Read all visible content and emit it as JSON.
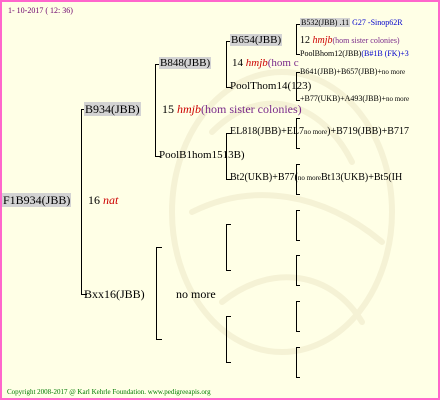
{
  "header": {
    "date": "1- 10-2017 ( 12: 36)"
  },
  "footer": {
    "text": "Copyright 2008-2017 @ Karl Kehrle Foundation.   www.pedigreeapis.org"
  },
  "colors": {
    "border": "#ff66cc",
    "background": "#ffffe6",
    "box": "#d3d3d3",
    "red": "#cc0000",
    "purple": "#7a2a8a",
    "blue": "#0000cc"
  },
  "gen0": {
    "label": "F1B934(JBB)",
    "num": "16",
    "note": "nat"
  },
  "gen1": [
    {
      "label": "B934(JBB)",
      "num": "15",
      "note": "hmjb",
      "note2": "(hom sister colonies)"
    },
    {
      "label": "Bxx16(JBB)",
      "extra": "no more"
    }
  ],
  "gen2": [
    {
      "label": "B848(JBB)",
      "num": "14",
      "note": "hmjb",
      "note2": "(hom c"
    },
    {
      "label": "PoolB1hom1513B)"
    }
  ],
  "gen3": [
    {
      "label": "B654(JBB)",
      "num": "12",
      "note": "hmjb",
      "note2": "(hom sister colonies)"
    },
    {
      "label": "PoolThom14(123)"
    },
    {
      "label": "EL818(JBB)+EL7",
      "more": "no more",
      "rest": ")+B719(JBB)+B717"
    },
    {
      "label": "Bt2(UKB)+B77(",
      "more": "no more",
      "rest": "Bt13(UKB)+Bt5(IH"
    }
  ],
  "gen4": [
    {
      "label": "B532(JBB) .11",
      "extra": "G27 -Sinop62R"
    },
    {
      "label": "PoolBhom12(JBB)",
      "extra": "(B#1B (FK)+3"
    },
    {
      "label": "B641(JBB)+B657(JBB)+",
      "extra": "no more"
    },
    {
      "label": "+B77(UKB)+A493(JBB)+",
      "extra": "no more"
    }
  ]
}
